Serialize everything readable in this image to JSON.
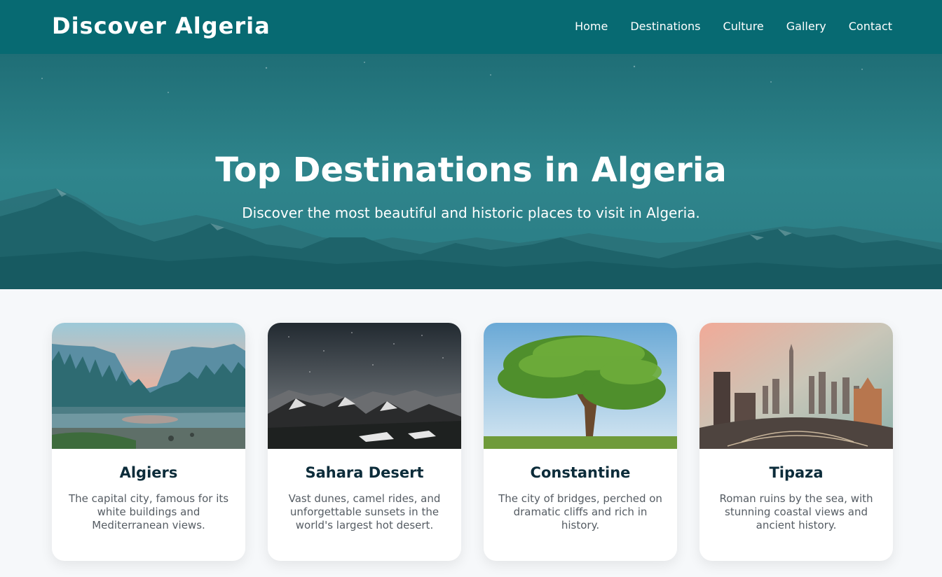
{
  "header": {
    "brand": "Discover Algeria",
    "nav": [
      "Home",
      "Destinations",
      "Culture",
      "Gallery",
      "Contact"
    ]
  },
  "hero": {
    "title": "Top Destinations in Algeria",
    "subtitle": "Discover the most beautiful and historic places to visit in Algeria."
  },
  "cards": [
    {
      "title": "Algiers",
      "description": "The capital city, famous for its white buildings and Mediterranean views.",
      "image": "forest-lake-landscape"
    },
    {
      "title": "Sahara Desert",
      "description": "Vast dunes, camel rides, and unforgettable sunsets in the world's largest hot desert.",
      "image": "mountain-night-sky"
    },
    {
      "title": "Constantine",
      "description": "The city of bridges, perched on dramatic cliffs and rich in history.",
      "image": "lone-tree-field"
    },
    {
      "title": "Tipaza",
      "description": "Roman ruins by the sea, with stunning coastal views and ancient history.",
      "image": "city-skyline-sunset"
    }
  ],
  "colors": {
    "header_bg": "#076a72",
    "hero_tint": "#1c6a72",
    "page_bg": "#f6f8fa",
    "card_title": "#0c2c3a",
    "card_text": "#555c63"
  }
}
